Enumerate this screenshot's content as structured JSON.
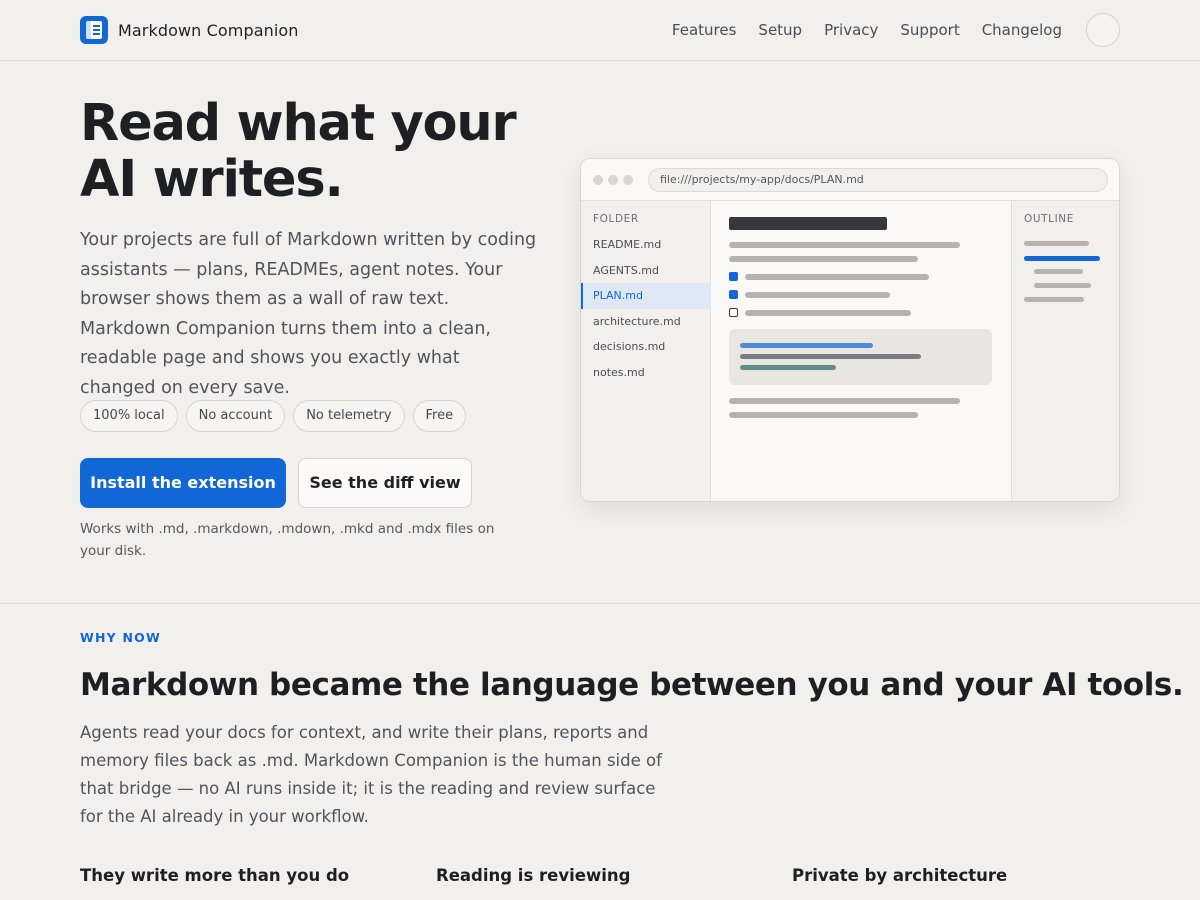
{
  "header": {
    "brand": "Markdown Companion",
    "nav": [
      "Features",
      "Setup",
      "Privacy",
      "Support",
      "Changelog"
    ]
  },
  "hero": {
    "title_line1": "Read what your",
    "title_line2": "AI writes.",
    "lede": "Your projects are full of Markdown written by coding assistants — plans, READMEs, agent notes. Your browser shows them as a wall of raw text. Markdown Companion turns them into a clean, readable page and shows you exactly what changed on every save.",
    "chips": [
      "100% local",
      "No account",
      "No telemetry",
      "Free"
    ],
    "primary_cta": "Install the extension",
    "secondary_cta": "See the diff view",
    "compat_note": "Works with .md, .markdown, .mdown, .mkd and .mdx files on your disk."
  },
  "mockup": {
    "url": "file:///projects/my-app/docs/PLAN.md",
    "folder_heading": "FOLDER",
    "files": [
      "README.md",
      "AGENTS.md",
      "PLAN.md",
      "architecture.md",
      "decisions.md",
      "notes.md"
    ],
    "active_file": "PLAN.md",
    "outline_heading": "OUTLINE"
  },
  "why_now": {
    "eyebrow": "WHY NOW",
    "heading": "Markdown became the language between you and your AI tools.",
    "body": "Agents read your docs for context, and write their plans, reports and memory files back as .md. Markdown Companion is the human side of that bridge — no AI runs inside it; it is the reading and review surface for the AI already in your workflow.",
    "columns": [
      "They write more than you do",
      "Reading is reviewing",
      "Private by architecture"
    ]
  },
  "colors": {
    "accent": "#1167d6",
    "background": "#f1f0ec"
  }
}
